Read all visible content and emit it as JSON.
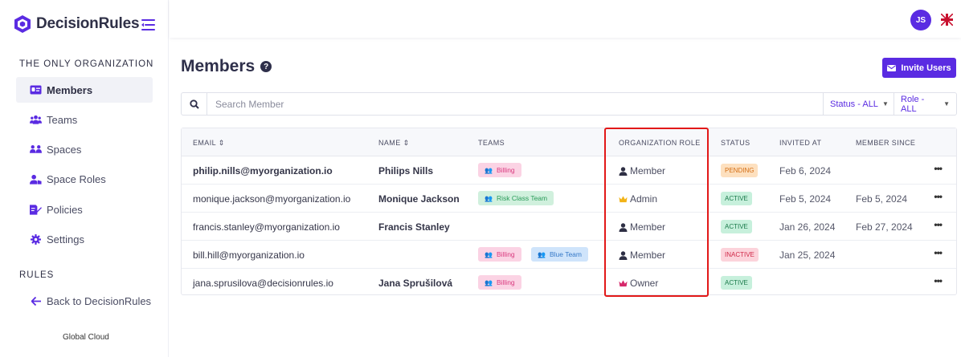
{
  "brand": {
    "name": "DecisionRules",
    "color": "#5a2be2"
  },
  "sidebar": {
    "org_section": "THE ONLY ORGANIZATION",
    "items": [
      {
        "label": "Members",
        "icon": "id-card-icon",
        "active": true
      },
      {
        "label": "Teams",
        "icon": "users-icon"
      },
      {
        "label": "Spaces",
        "icon": "spaces-icon"
      },
      {
        "label": "Space Roles",
        "icon": "user-tag-icon"
      },
      {
        "label": "Policies",
        "icon": "pen-doc-icon"
      },
      {
        "label": "Settings",
        "icon": "gear-icon"
      }
    ],
    "rules_section": "RULES",
    "back_label": "Back to DecisionRules",
    "region": "Global Cloud"
  },
  "topbar": {
    "avatar_initials": "JS",
    "flag": "uk-flag-icon"
  },
  "main": {
    "title": "Members",
    "invite_label": "Invite Users",
    "search_placeholder": "Search Member",
    "status_filter": "Status - ALL",
    "role_filter": "Role - ALL"
  },
  "table": {
    "headers": {
      "email": "EMAIL ⇕",
      "name": "NAME ⇕",
      "teams": "TEAMS",
      "role": "ORGANIZATION ROLE",
      "status": "STATUS",
      "invited": "INVITED AT",
      "since": "MEMBER SINCE"
    },
    "rows": [
      {
        "email": "philip.nills@myorganization.io",
        "name": "Philips Nills",
        "team1": "Billing",
        "team2": "",
        "role": "Member",
        "status": "PENDING",
        "invited": "Feb 6, 2024",
        "since": ""
      },
      {
        "email": "monique.jackson@myorganization.io",
        "name": "Monique Jackson",
        "team1": "Risk Class Team",
        "team2": "",
        "role": "Admin",
        "status": "ACTIVE",
        "invited": "Feb 5, 2024",
        "since": "Feb 5, 2024"
      },
      {
        "email": "francis.stanley@myorganization.io",
        "name": "Francis Stanley",
        "team1": "",
        "team2": "",
        "role": "Member",
        "status": "ACTIVE",
        "invited": "Jan 26, 2024",
        "since": "Feb 27, 2024"
      },
      {
        "email": "bill.hill@myorganization.io",
        "name": "",
        "team1": "Billing",
        "team2": "Blue Team",
        "role": "Member",
        "status": "INACTIVE",
        "invited": "Jan 25, 2024",
        "since": ""
      },
      {
        "email": "jana.sprusilova@decisionrules.io",
        "name": "Jana Sprušilová",
        "team1": "Billing",
        "team2": "",
        "role": "Owner",
        "status": "ACTIVE",
        "invited": "",
        "since": ""
      }
    ],
    "more_label": "•••"
  }
}
